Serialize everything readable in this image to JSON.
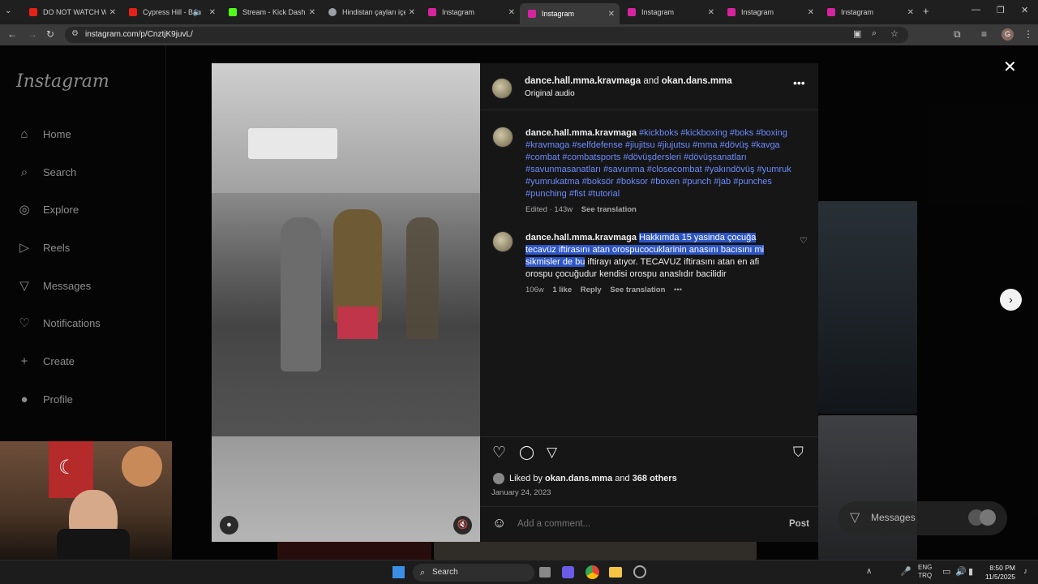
{
  "browser": {
    "tabs": [
      {
        "title": "DO NOT WATCH WH",
        "fav_color": "#e62117"
      },
      {
        "title": "Cypress Hill - Ban",
        "fav_color": "#e62117"
      },
      {
        "title": "Stream - Kick Dashbo",
        "fav_color": "#53fc18"
      },
      {
        "title": "Hindistan çayları içeri",
        "fav_color": "#9aa0a6"
      },
      {
        "title": "Instagram",
        "fav_color": "#d6249f"
      },
      {
        "title": "Instagram",
        "fav_color": "#d6249f"
      },
      {
        "title": "Instagram",
        "fav_color": "#d6249f"
      },
      {
        "title": "Instagram",
        "fav_color": "#d6249f"
      },
      {
        "title": "Instagram",
        "fav_color": "#d6249f"
      }
    ],
    "url": "instagram.com/p/CnztjK9juvL/",
    "new_tab": "+",
    "profile_letter": "G"
  },
  "sidebar": {
    "logo": "Instagram",
    "items": [
      {
        "label": "Home",
        "icon": "⌂"
      },
      {
        "label": "Search",
        "icon": "⌕"
      },
      {
        "label": "Explore",
        "icon": "◎"
      },
      {
        "label": "Reels",
        "icon": "▷"
      },
      {
        "label": "Messages",
        "icon": "▽"
      },
      {
        "label": "Notifications",
        "icon": "♡"
      },
      {
        "label": "Create",
        "icon": "+"
      },
      {
        "label": "Profile",
        "icon": "●"
      }
    ]
  },
  "post": {
    "author": "dance.hall.mma.kravmaga",
    "and_text": "and",
    "coauthor": "okan.dans.mma",
    "audio": "Original audio",
    "caption_author": "dance.hall.mma.kravmaga",
    "caption_lines": [
      "#kickboks #kickboxing #boks #boxing",
      "#kravmaga #selfdefense #jiujitsu #jiujutsu #mma #dövüş #kavga",
      "#combat #combatsports #dövüşdersleri #dövüşsanatları",
      "#savunmasanatları #savunma #closecombat #yakındövüş #yumruk",
      "#yumrukatma #boksör #boksor #boxen #punch #jab #punches",
      "#punching #fist #tutorial"
    ],
    "caption_meta": "Edited · 143w",
    "see_translation": "See translation",
    "comment": {
      "author": "dance.hall.mma.kravmaga",
      "line1_highlight": "Hakkımda 15 yasinda çocuğa",
      "line2_highlight": "tecavüz iftirasını atan orospucocuklarinin anasını bacısını mi",
      "line3_highlight": "sikmisler de bu",
      "line3_rest": " iftirayı atıyor. TECAVUZ iftirasını atan en afi",
      "line4": "orospu çocuğudur kendisi orospu anaslıdır bacilidir",
      "time": "106w",
      "likes": "1 like",
      "reply": "Reply",
      "see_translation": "See translation"
    },
    "liked_by_prefix": "Liked by",
    "liked_by_user": "okan.dans.mma",
    "liked_by_and": "and",
    "liked_by_others": "368 others",
    "date": "January 24, 2023",
    "comment_placeholder": "Add a comment...",
    "post_button": "Post"
  },
  "floating": {
    "messages_label": "Messages"
  },
  "taskbar": {
    "search_label": "Search",
    "lang_top": "ENG",
    "lang_bottom": "TRQ",
    "time": "8:50 PM",
    "date": "11/5/2025"
  }
}
